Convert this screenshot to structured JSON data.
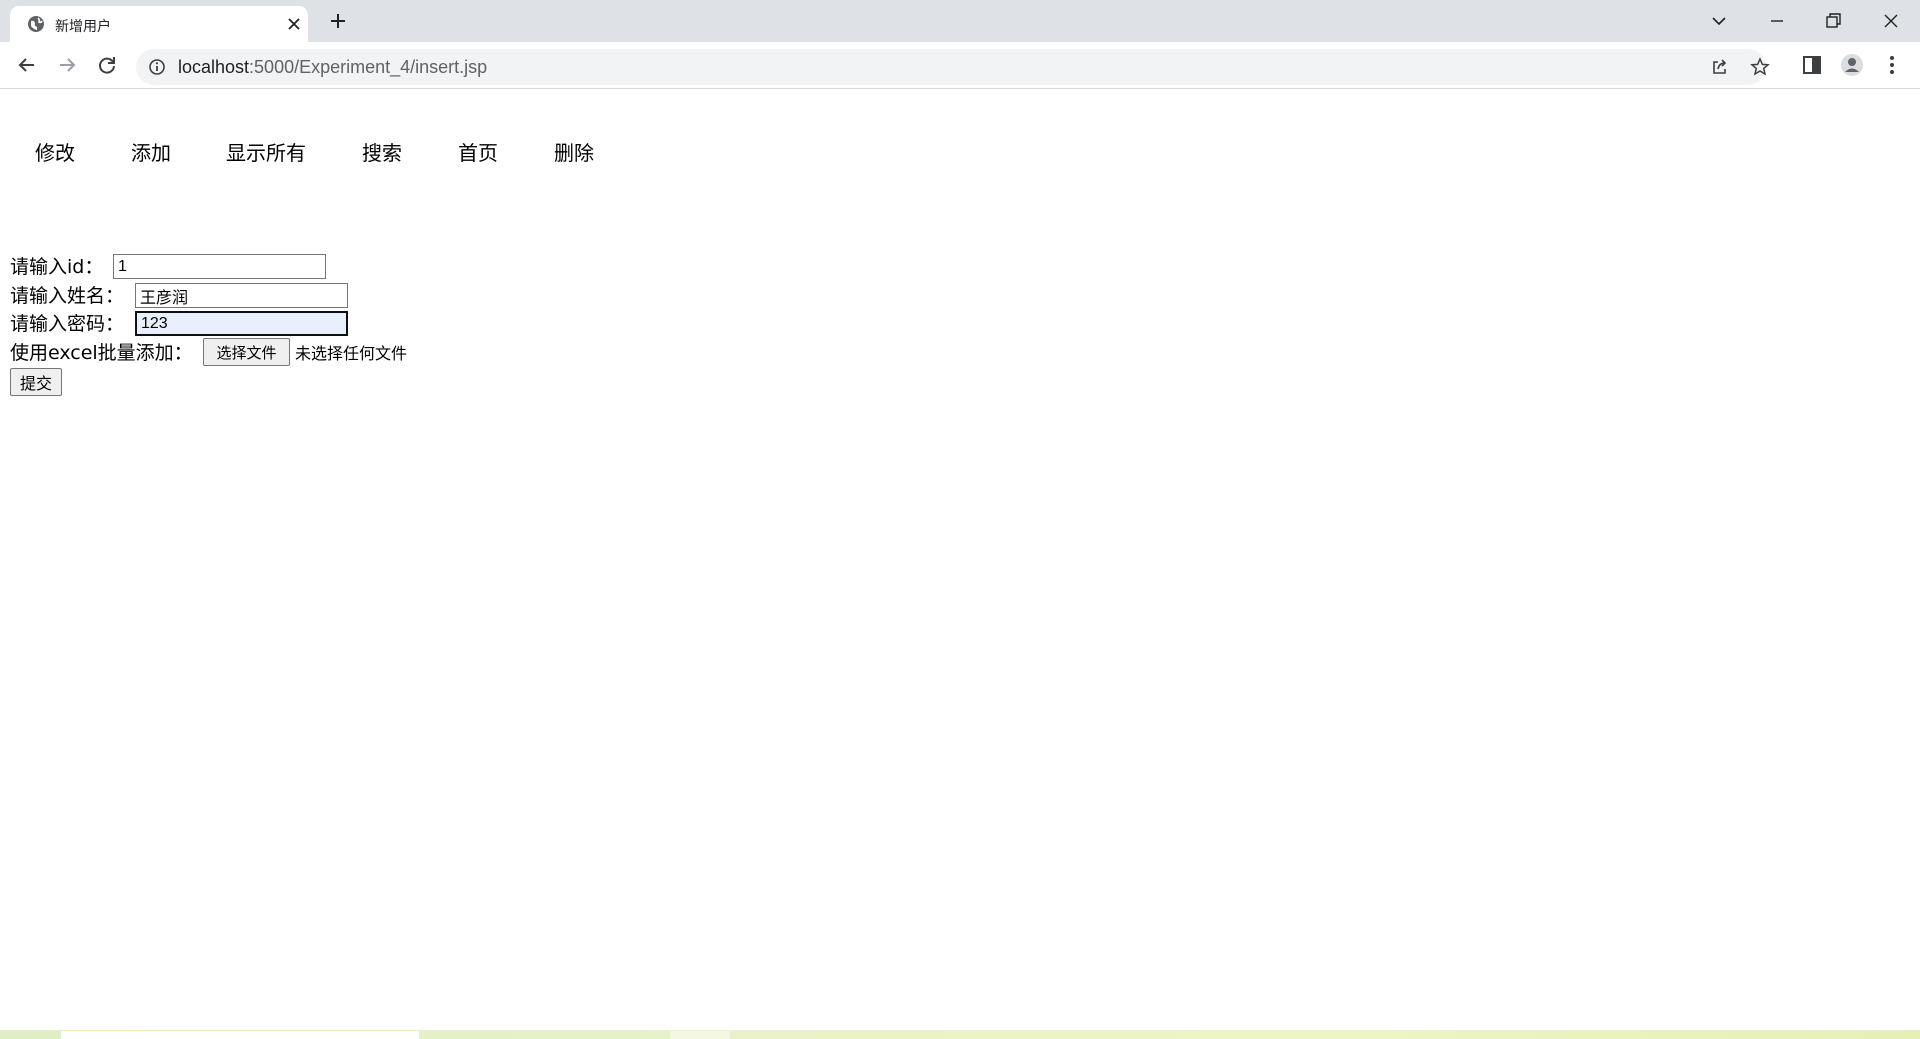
{
  "browser": {
    "tab_title": "新增用户",
    "url_host": "localhost",
    "url_rest": ":5000/Experiment_4/insert.jsp"
  },
  "icons": {
    "favicon": "globe-icon",
    "tab_close": "close-icon",
    "new_tab": "plus-icon",
    "back": "back-arrow-icon",
    "forward": "forward-arrow-icon",
    "reload": "reload-icon",
    "site_info": "info-icon",
    "share": "share-icon",
    "bookmark": "star-icon",
    "side_panel": "side-panel-icon",
    "profile": "profile-icon",
    "menu": "kebab-menu-icon",
    "tab_search": "chevron-down-icon",
    "minimize": "minimize-icon",
    "restore": "restore-icon",
    "close_window": "close-icon"
  },
  "nav": {
    "items": [
      {
        "label": "修改"
      },
      {
        "label": "添加"
      },
      {
        "label": "显示所有"
      },
      {
        "label": "搜索"
      },
      {
        "label": "首页"
      },
      {
        "label": "删除"
      }
    ]
  },
  "form": {
    "id_label": "请输入id：",
    "id_value": "1",
    "name_label": "请输入姓名：",
    "name_value": "王彦润",
    "password_label": "请输入密码：",
    "password_value": "123",
    "excel_label": "使用excel批量添加：",
    "file_button": "选择文件",
    "file_status": "未选择任何文件",
    "submit": "提交"
  }
}
